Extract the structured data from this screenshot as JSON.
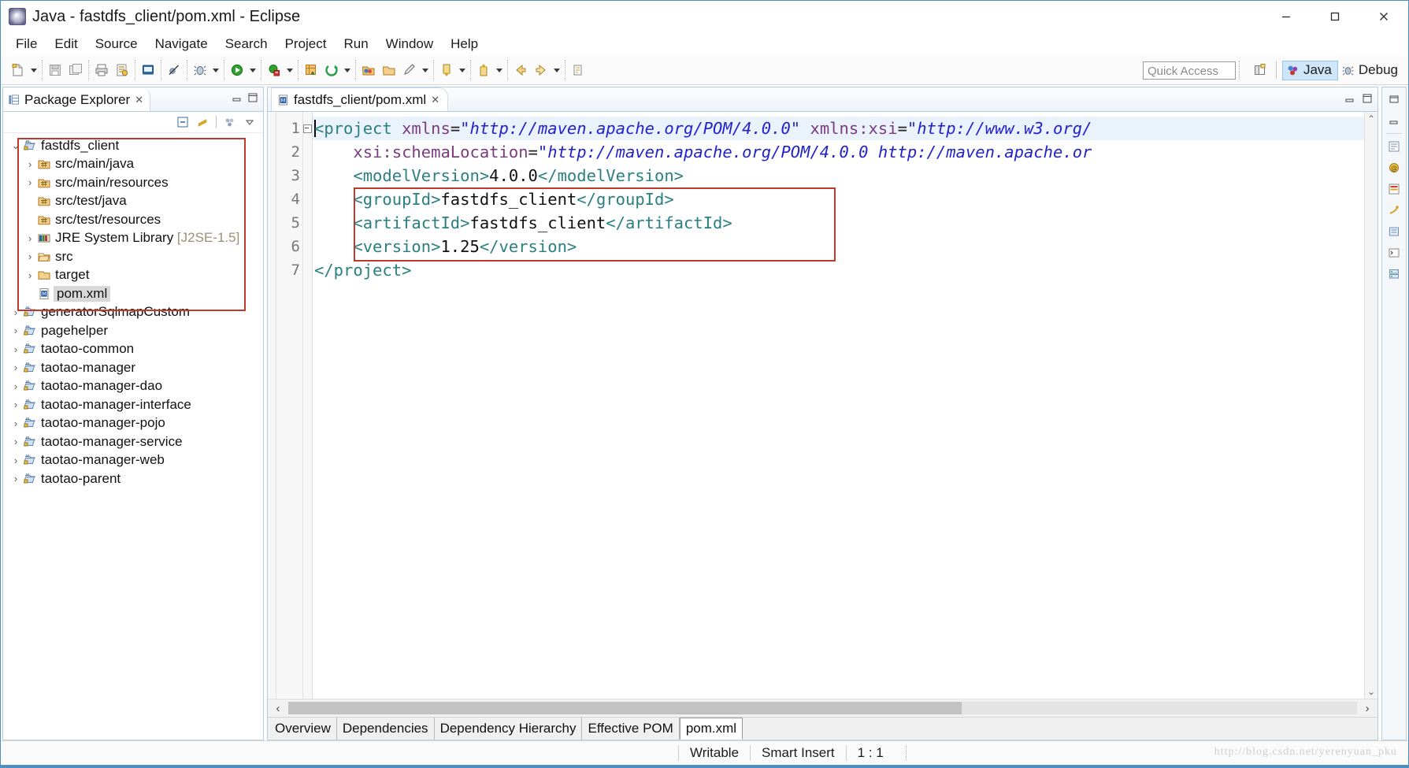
{
  "window": {
    "title": "Java - fastdfs_client/pom.xml - Eclipse",
    "app_icon": "eclipse-icon",
    "controls": {
      "minimize": "minimize-icon",
      "maximize": "maximize-icon",
      "close": "close-icon"
    }
  },
  "menubar": {
    "items": [
      "File",
      "Edit",
      "Source",
      "Navigate",
      "Search",
      "Project",
      "Run",
      "Window",
      "Help"
    ]
  },
  "toolbar": {
    "groups": [
      {
        "buttons": [
          {
            "name": "new-wizard-button",
            "icon": "new-file-icon",
            "dropdown": true
          }
        ]
      },
      {
        "buttons": [
          {
            "name": "save-button",
            "icon": "save-icon",
            "dropdown": false
          },
          {
            "name": "save-all-button",
            "icon": "save-all-icon",
            "dropdown": false
          }
        ]
      },
      {
        "buttons": [
          {
            "name": "print-button",
            "icon": "print-icon",
            "dropdown": false
          },
          {
            "name": "validate-button",
            "icon": "validate-icon",
            "dropdown": false
          }
        ]
      },
      {
        "buttons": [
          {
            "name": "open-type-button",
            "icon": "open-type-icon",
            "dropdown": false
          }
        ]
      },
      {
        "buttons": [
          {
            "name": "skip-breakpoints-button",
            "icon": "skip-breakpoints-icon",
            "dropdown": false
          }
        ]
      },
      {
        "buttons": [
          {
            "name": "debug-button",
            "icon": "debug-bug-icon",
            "dropdown": true
          }
        ]
      },
      {
        "buttons": [
          {
            "name": "run-button",
            "icon": "run-play-icon",
            "dropdown": true
          }
        ]
      },
      {
        "buttons": [
          {
            "name": "run-coverage-button",
            "icon": "coverage-icon",
            "dropdown": true
          }
        ]
      },
      {
        "buttons": [
          {
            "name": "new-java-package-button",
            "icon": "new-package-icon",
            "dropdown": false
          },
          {
            "name": "external-tools-button",
            "icon": "external-tools-icon",
            "dropdown": true
          }
        ]
      },
      {
        "buttons": [
          {
            "name": "open-task-button",
            "icon": "open-task-icon",
            "dropdown": false
          },
          {
            "name": "open-folder-button",
            "icon": "folder-icon",
            "dropdown": false
          },
          {
            "name": "link-button",
            "icon": "pencil-icon",
            "dropdown": true
          }
        ]
      },
      {
        "buttons": [
          {
            "name": "next-annotation-button",
            "icon": "next-annotation-icon",
            "dropdown": true
          }
        ]
      },
      {
        "buttons": [
          {
            "name": "previous-annotation-button",
            "icon": "previous-annotation-icon",
            "dropdown": true
          }
        ]
      },
      {
        "buttons": [
          {
            "name": "back-button",
            "icon": "back-arrow-icon",
            "dropdown": false
          },
          {
            "name": "forward-button",
            "icon": "forward-arrow-icon",
            "dropdown": true
          }
        ]
      },
      {
        "buttons": [
          {
            "name": "last-edit-location-button",
            "icon": "last-edit-icon",
            "dropdown": true
          }
        ]
      }
    ],
    "quick_access_placeholder": "Quick Access",
    "open-perspective-button": "open-perspective-icon",
    "perspectives": [
      {
        "label": "Java",
        "icon": "java-perspective-icon",
        "active": true
      },
      {
        "label": "Debug",
        "icon": "debug-perspective-icon",
        "active": false
      }
    ]
  },
  "package_explorer": {
    "tab_label": "Package Explorer",
    "tab_icon": "package-explorer-icon",
    "tab_close": "✕",
    "view_buttons": [
      "minimize-view-icon",
      "maximize-view-icon"
    ],
    "toolbar_buttons": [
      "collapse-all-icon",
      "link-with-editor-icon",
      "view-menu-filters-icon",
      "view-menu-icon"
    ],
    "tree": [
      {
        "label": "fastdfs_client",
        "indent": 0,
        "twisty": "v",
        "icon": "maven-project-icon",
        "selected": false
      },
      {
        "label": "src/main/java",
        "indent": 1,
        "twisty": ">",
        "icon": "source-folder-icon",
        "selected": false
      },
      {
        "label": "src/main/resources",
        "indent": 1,
        "twisty": ">",
        "icon": "source-folder-icon",
        "selected": false
      },
      {
        "label": "src/test/java",
        "indent": 1,
        "twisty": "",
        "icon": "source-folder-icon",
        "selected": false
      },
      {
        "label": "src/test/resources",
        "indent": 1,
        "twisty": "",
        "icon": "source-folder-icon",
        "selected": false
      },
      {
        "label": "JRE System Library",
        "suffix": " [J2SE-1.5]",
        "indent": 1,
        "twisty": ">",
        "icon": "jre-library-icon",
        "selected": false
      },
      {
        "label": "src",
        "indent": 1,
        "twisty": ">",
        "icon": "folder-open-icon",
        "selected": false
      },
      {
        "label": "target",
        "indent": 1,
        "twisty": ">",
        "icon": "folder-icon",
        "selected": false
      },
      {
        "label": "pom.xml",
        "indent": 1,
        "twisty": "",
        "icon": "xml-file-icon",
        "selected": true
      },
      {
        "label": "generatorSqlmapCustom",
        "indent": 0,
        "twisty": ">",
        "icon": "maven-project-icon",
        "selected": false
      },
      {
        "label": "pagehelper",
        "indent": 0,
        "twisty": ">",
        "icon": "maven-project-icon",
        "selected": false
      },
      {
        "label": "taotao-common",
        "indent": 0,
        "twisty": ">",
        "icon": "maven-project-icon",
        "selected": false
      },
      {
        "label": "taotao-manager",
        "indent": 0,
        "twisty": ">",
        "icon": "maven-project-icon",
        "selected": false
      },
      {
        "label": "taotao-manager-dao",
        "indent": 0,
        "twisty": ">",
        "icon": "maven-project-icon",
        "selected": false
      },
      {
        "label": "taotao-manager-interface",
        "indent": 0,
        "twisty": ">",
        "icon": "maven-project-icon",
        "selected": false
      },
      {
        "label": "taotao-manager-pojo",
        "indent": 0,
        "twisty": ">",
        "icon": "maven-project-icon",
        "selected": false
      },
      {
        "label": "taotao-manager-service",
        "indent": 0,
        "twisty": ">",
        "icon": "maven-project-icon",
        "selected": false
      },
      {
        "label": "taotao-manager-web",
        "indent": 0,
        "twisty": ">",
        "icon": "maven-project-icon",
        "selected": false
      },
      {
        "label": "taotao-parent",
        "indent": 0,
        "twisty": ">",
        "icon": "maven-project-icon",
        "selected": false
      }
    ],
    "highlight_color": "#c0392b"
  },
  "editor": {
    "tab_label": "fastdfs_client/pom.xml",
    "tab_icon": "xml-file-icon",
    "tab_close": "✕",
    "view_buttons": [
      "minimize-view-icon",
      "maximize-view-icon"
    ],
    "line_numbers": [
      "1",
      "2",
      "3",
      "4",
      "5",
      "6",
      "7"
    ],
    "code_lines": [
      {
        "n": 1,
        "current": true,
        "folded_marker": true,
        "tokens": [
          {
            "t": "tag",
            "v": "<project"
          },
          {
            "t": "text",
            "v": " "
          },
          {
            "t": "attr",
            "v": "xmlns"
          },
          {
            "t": "eq",
            "v": "="
          },
          {
            "t": "str",
            "v": "\"http://maven.apache.org/POM/4.0.0\""
          },
          {
            "t": "text",
            "v": " "
          },
          {
            "t": "attr",
            "v": "xmlns:xsi"
          },
          {
            "t": "eq",
            "v": "="
          },
          {
            "t": "str",
            "v": "\"http://www.w3.org/"
          }
        ]
      },
      {
        "n": 2,
        "current": false,
        "folded_marker": false,
        "tokens": [
          {
            "t": "text",
            "v": "    "
          },
          {
            "t": "attr",
            "v": "xsi:schemaLocation"
          },
          {
            "t": "eq",
            "v": "="
          },
          {
            "t": "str",
            "v": "\"http://maven.apache.org/POM/4.0.0 http://maven.apache.or"
          }
        ]
      },
      {
        "n": 3,
        "current": false,
        "folded_marker": false,
        "tokens": [
          {
            "t": "text",
            "v": "    "
          },
          {
            "t": "tag",
            "v": "<modelVersion>"
          },
          {
            "t": "text",
            "v": "4.0.0"
          },
          {
            "t": "tag",
            "v": "</modelVersion>"
          }
        ]
      },
      {
        "n": 4,
        "current": false,
        "folded_marker": false,
        "tokens": [
          {
            "t": "text",
            "v": "    "
          },
          {
            "t": "tag",
            "v": "<groupId>"
          },
          {
            "t": "text",
            "v": "fastdfs_client"
          },
          {
            "t": "tag",
            "v": "</groupId>"
          }
        ]
      },
      {
        "n": 5,
        "current": false,
        "folded_marker": false,
        "tokens": [
          {
            "t": "text",
            "v": "    "
          },
          {
            "t": "tag",
            "v": "<artifactId>"
          },
          {
            "t": "text",
            "v": "fastdfs_client"
          },
          {
            "t": "tag",
            "v": "</artifactId>"
          }
        ]
      },
      {
        "n": 6,
        "current": false,
        "folded_marker": false,
        "tokens": [
          {
            "t": "text",
            "v": "    "
          },
          {
            "t": "tag",
            "v": "<version>"
          },
          {
            "t": "text",
            "v": "1.25"
          },
          {
            "t": "tag",
            "v": "</version>"
          }
        ]
      },
      {
        "n": 7,
        "current": false,
        "folded_marker": false,
        "tokens": [
          {
            "t": "tag",
            "v": "</project>"
          }
        ]
      }
    ],
    "highlight_color": "#c0392b",
    "bottom_tabs": [
      {
        "label": "Overview",
        "active": false
      },
      {
        "label": "Dependencies",
        "active": false
      },
      {
        "label": "Dependency Hierarchy",
        "active": false
      },
      {
        "label": "Effective POM",
        "active": false
      },
      {
        "label": "pom.xml",
        "active": true
      }
    ],
    "scroll_left_arrow": "‹",
    "scroll_right_arrow": "›",
    "vscroll_up_arrow": "⌃",
    "vscroll_down_arrow": "⌄"
  },
  "rightbar": {
    "buttons": [
      "restore-view-icon",
      "minimize-view-icon",
      "outline-view-icon",
      "task-list-icon",
      "problems-view-icon",
      "javadoc-view-icon",
      "declaration-view-icon",
      "console-view-icon",
      "servers-view-icon"
    ]
  },
  "statusbar": {
    "writable": "Writable",
    "insert_mode": "Smart Insert",
    "cursor_position": "1 : 1",
    "watermark": "http://blog.csdn.net/yerenyuan_pku"
  },
  "colors": {
    "accent": "#4a90c4",
    "highlight_box": "#c0392b",
    "xml_tag": "#2a7f80",
    "xml_attr": "#7c3a80",
    "xml_string": "#2222cc",
    "current_line": "#eaf2fb",
    "selection": "#d8d8d8",
    "perspective_active": "#cfe5f8"
  }
}
